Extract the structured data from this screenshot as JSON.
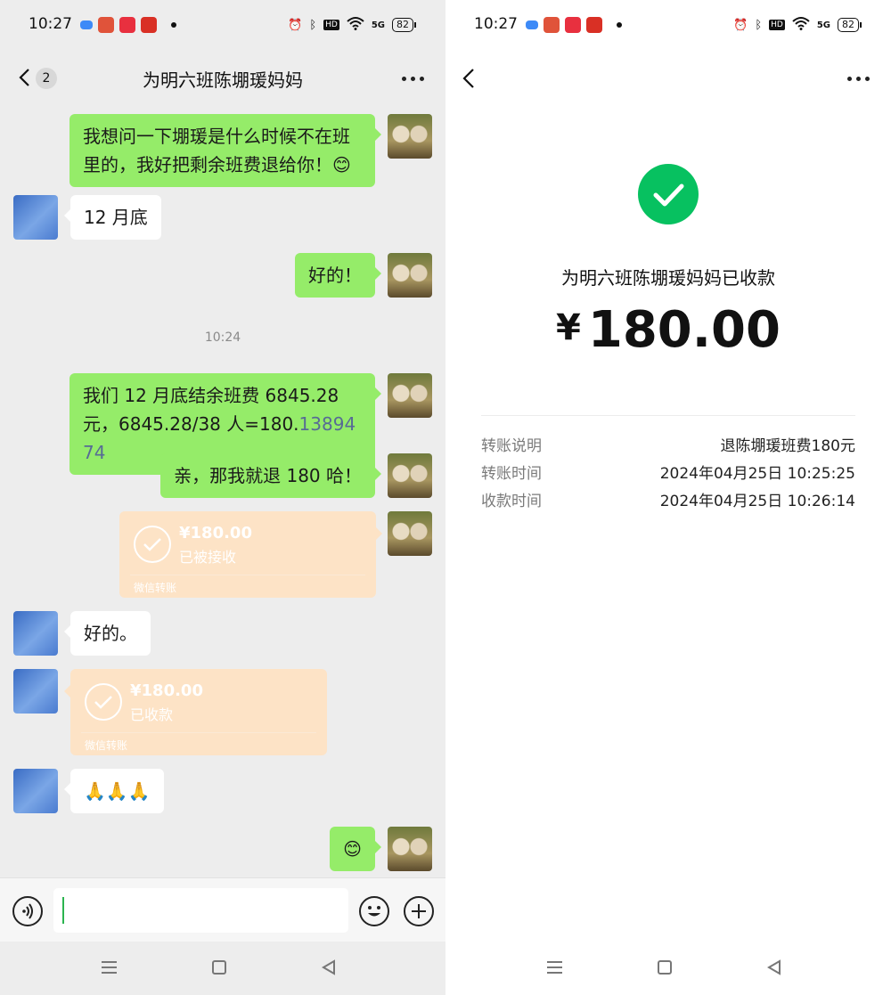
{
  "status_bar": {
    "time": "10:27",
    "battery": "82",
    "app_icons": [
      "message-app-icon",
      "game-app-icon",
      "video-app-icon",
      "listen-app-icon"
    ],
    "indicators": [
      "alarm-icon",
      "bluetooth-icon",
      "hd-icon",
      "wifi-icon",
      "5g-signal-icon"
    ],
    "hd_label": "HD",
    "network_label": "5G"
  },
  "chat": {
    "title": "为明六班陈堋瑗妈妈",
    "unread_count": "2",
    "messages": [
      {
        "from": "me",
        "text": "我想问一下堋瑗是什么时候不在班里的，我好把剩余班费退给你！😊"
      },
      {
        "from": "them",
        "text": "12 月底"
      },
      {
        "from": "me",
        "text": "好的！"
      },
      {
        "type": "time",
        "text": "10:24"
      },
      {
        "from": "me",
        "text_prefix": "我们 12 月底结余班费 6845.28 元，6845.28/38 人=180.",
        "text_link": "1389474"
      },
      {
        "from": "me",
        "text": "亲，那我就退 180 哈！"
      },
      {
        "from": "me",
        "type": "transfer",
        "amount": "¥180.00",
        "status": "已被接收",
        "label": "微信转账"
      },
      {
        "from": "them",
        "text": "好的。"
      },
      {
        "from": "them",
        "type": "transfer",
        "amount": "¥180.00",
        "status": "已收款",
        "label": "微信转账"
      },
      {
        "from": "them",
        "text": "🙏🙏🙏"
      },
      {
        "from": "me",
        "text": "😊"
      }
    ],
    "input_value": ""
  },
  "receipt": {
    "title": "为明六班陈堋瑗妈妈已收款",
    "currency": "¥",
    "amount": "180.00",
    "details": [
      {
        "key": "转账说明",
        "value": "退陈堋瑗班费180元"
      },
      {
        "key": "转账时间",
        "value": "2024年04月25日 10:25:25"
      },
      {
        "key": "收款时间",
        "value": "2024年04月25日 10:26:14"
      }
    ]
  },
  "colors": {
    "my_bubble": "#95ec69",
    "their_bubble": "#ffffff",
    "transfer_card": "#fde3c6",
    "success_green": "#07c160",
    "link": "#576b95"
  }
}
